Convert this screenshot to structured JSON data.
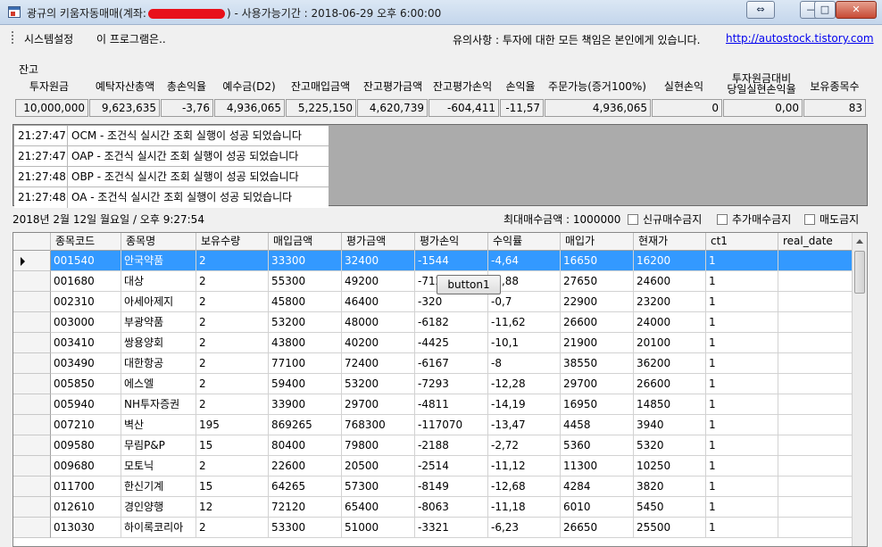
{
  "window": {
    "title_prefix": "광규의 키움자동매매(계좌:",
    "title_suffix": ") - 사용가능기간 : 2018-06-29 오후 6:00:00",
    "btn_restore": "⇔",
    "btn_min": "—",
    "btn_max": "□",
    "btn_close": "✕"
  },
  "menu": {
    "system_settings": "시스템설정",
    "about": "이 프로그램은..",
    "notice": "유의사항 : 투자에 대한 모든 책임은 본인에게 있습니다.",
    "link": "http://autostock.tistory.com"
  },
  "balance": {
    "group_label": "잔고",
    "headers": [
      "투자원금",
      "예탁자산총액",
      "총손익율",
      "예수금(D2)",
      "잔고매입금액",
      "잔고평가금액",
      "잔고평가손익",
      "손익율",
      "주문가능(증거100%)",
      "실현손익",
      "투자원금대비",
      "당일실현손익율",
      "보유종목수"
    ],
    "values": [
      "10,000,000",
      "9,623,635",
      "-3,76",
      "4,936,065",
      "5,225,150",
      "4,620,739",
      "-604,411",
      "-11,57",
      "4,936,065",
      "0",
      "0,00",
      "83"
    ]
  },
  "log": [
    {
      "time": "21:27:47",
      "msg": "OCM - 조건식 실시간 조회 실행이 성공 되었습니다"
    },
    {
      "time": "21:27:47",
      "msg": "OAP - 조건식 실시간 조회 실행이 성공 되었습니다"
    },
    {
      "time": "21:27:48",
      "msg": "OBP - 조건식 실시간 조회 실행이 성공 되었습니다"
    },
    {
      "time": "21:27:48",
      "msg": "OA - 조건식 실시간 조회 실행이 성공 되었습니다"
    }
  ],
  "status": {
    "datetime": "2018년 2월 12일 월요일 / 오후 9:27:54",
    "max_buy": "최대매수금액 : 1000000",
    "chk_new_buy": "신규매수금지",
    "chk_add_buy": "추가매수금지",
    "chk_sell": "매도금지"
  },
  "grid": {
    "columns": [
      "종목코드",
      "종목명",
      "보유수량",
      "매입금액",
      "평가금액",
      "평가손익",
      "수익률",
      "매입가",
      "현재가",
      "ct1",
      "real_date"
    ],
    "rows": [
      [
        "001540",
        "안국약품",
        "2",
        "33300",
        "32400",
        "-1544",
        "-4,64",
        "16650",
        "16200",
        "1",
        ""
      ],
      [
        "001680",
        "대상",
        "2",
        "55300",
        "49200",
        "-712",
        "-2,88",
        "27650",
        "24600",
        "1",
        ""
      ],
      [
        "002310",
        "아세아제지",
        "2",
        "45800",
        "46400",
        "-320",
        "-0,7",
        "22900",
        "23200",
        "1",
        ""
      ],
      [
        "003000",
        "부광약품",
        "2",
        "53200",
        "48000",
        "-6182",
        "-11,62",
        "26600",
        "24000",
        "1",
        ""
      ],
      [
        "003410",
        "쌍용양회",
        "2",
        "43800",
        "40200",
        "-4425",
        "-10,1",
        "21900",
        "20100",
        "1",
        ""
      ],
      [
        "003490",
        "대한항공",
        "2",
        "77100",
        "72400",
        "-6167",
        "-8",
        "38550",
        "36200",
        "1",
        ""
      ],
      [
        "005850",
        "에스엘",
        "2",
        "59400",
        "53200",
        "-7293",
        "-12,28",
        "29700",
        "26600",
        "1",
        ""
      ],
      [
        "005940",
        "NH투자증권",
        "2",
        "33900",
        "29700",
        "-4811",
        "-14,19",
        "16950",
        "14850",
        "1",
        ""
      ],
      [
        "007210",
        "벽산",
        "195",
        "869265",
        "768300",
        "-117070",
        "-13,47",
        "4458",
        "3940",
        "1",
        ""
      ],
      [
        "009580",
        "무림P&P",
        "15",
        "80400",
        "79800",
        "-2188",
        "-2,72",
        "5360",
        "5320",
        "1",
        ""
      ],
      [
        "009680",
        "모토닉",
        "2",
        "22600",
        "20500",
        "-2514",
        "-11,12",
        "11300",
        "10250",
        "1",
        ""
      ],
      [
        "011700",
        "한신기계",
        "15",
        "64265",
        "57300",
        "-8149",
        "-12,68",
        "4284",
        "3820",
        "1",
        ""
      ],
      [
        "012610",
        "경인양행",
        "12",
        "72120",
        "65400",
        "-8063",
        "-11,18",
        "6010",
        "5450",
        "1",
        ""
      ],
      [
        "013030",
        "하이록코리아",
        "2",
        "53300",
        "51000",
        "-3321",
        "-6,23",
        "26650",
        "25500",
        "1",
        ""
      ]
    ],
    "selected_row": 0
  },
  "button1": "button1"
}
